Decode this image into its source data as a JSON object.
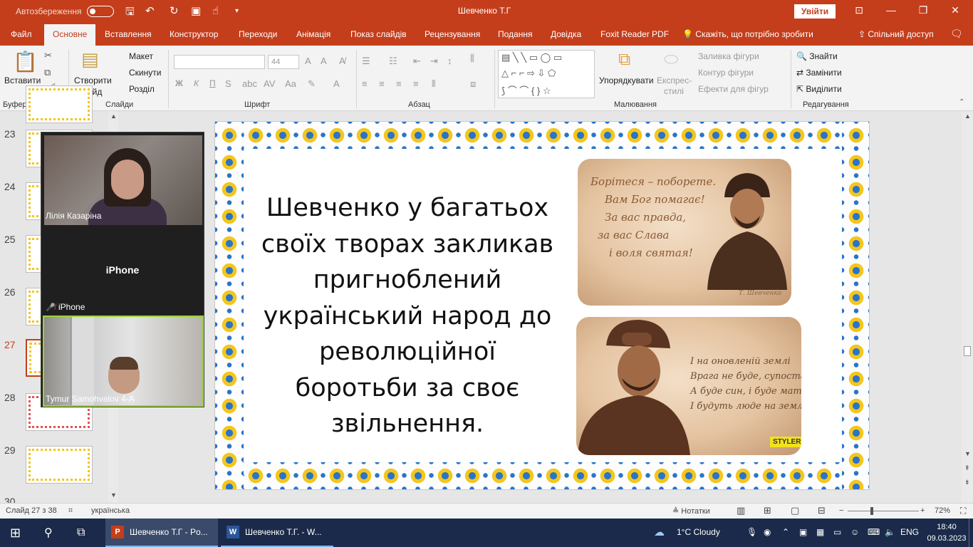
{
  "window": {
    "autosave_label": "Автозбереження",
    "title": "Шевченко Т.Г",
    "signin_label": "Увійти"
  },
  "tabs": [
    {
      "label": "Файл"
    },
    {
      "label": "Основне"
    },
    {
      "label": "Вставлення"
    },
    {
      "label": "Конструктор"
    },
    {
      "label": "Переходи"
    },
    {
      "label": "Анімація"
    },
    {
      "label": "Показ слайдів"
    },
    {
      "label": "Рецензування"
    },
    {
      "label": "Подання"
    },
    {
      "label": "Довідка"
    },
    {
      "label": "Foxit Reader PDF"
    }
  ],
  "tell_me": "Скажіть, що потрібно зробити",
  "share_label": "Спільний доступ",
  "ribbon": {
    "paste": "Вставити",
    "new_slide_1": "Створити",
    "new_slide_2": "слайд",
    "layout": "Макет",
    "reset": "Скинути",
    "section": "Розділ",
    "font_size": "44",
    "arrange": "Упорядкувати",
    "quick_styles_1": "Експрес-",
    "quick_styles_2": "стилі",
    "shape_fill": "Заливка фігури",
    "shape_outline": "Контур фігури",
    "shape_effects": "Ефекти для фігур",
    "find": "Знайти",
    "replace": "Замінити",
    "select": "Виділити",
    "bold": "Ж",
    "italic": "К",
    "underline": "П",
    "groups": {
      "clipboard": "Буфер обміну",
      "slides": "Слайди",
      "font": "Шрифт",
      "paragraph": "Абзац",
      "drawing": "Малювання",
      "editing": "Редагування"
    }
  },
  "thumbnails": [
    {
      "num": "23"
    },
    {
      "num": "24"
    },
    {
      "num": "25"
    },
    {
      "num": "26"
    },
    {
      "num": "27"
    },
    {
      "num": "28"
    },
    {
      "num": "29"
    },
    {
      "num": "30"
    }
  ],
  "zoom": {
    "participant1": "Лілія Казаріна",
    "participant2_big": "iPhone",
    "participant2": "iPhone",
    "participant3": "Tymur Samohvalov 4-A"
  },
  "slide": {
    "text": "Шевченко у багатьох своїх творах закликав пригноблений український народ до революційної боротьби за своє звільнення.",
    "quote1": [
      "Борітеся – поборете.",
      "Вам Бог помагає!",
      "За вас правда,",
      "за вас Слава",
      "і воля святая!"
    ],
    "signature": "Т. Шевченко",
    "quote2": [
      "І на оновленій землі",
      "Врага не буде, супостата,",
      "А буде син, і буде мати,",
      "І будуть люде на землі."
    ],
    "badge": "STYLER"
  },
  "status": {
    "slide_info": "Слайд 27 з 38",
    "language": "українська",
    "notes": "Нотатки",
    "zoom": "72%"
  },
  "taskbar": {
    "app1": "Шевченко Т.Г - Po...",
    "app2": "Шевченко Т.Г. - W...",
    "weather": "1°C  Cloudy",
    "lang": "ENG",
    "time": "18:40",
    "date": "09.03.2023"
  },
  "colors": {
    "accent": "#c43e1c",
    "taskbar": "#1b2a4a",
    "ornament_blue": "#2a74c9",
    "ornament_yellow": "#f4c61c"
  }
}
